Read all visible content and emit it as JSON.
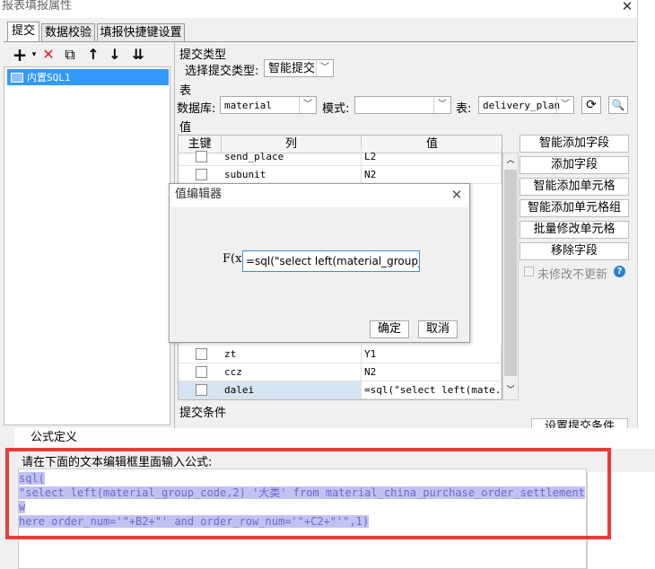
{
  "window": {
    "title": "报表填报属性"
  },
  "tabs": [
    {
      "label": "提交"
    },
    {
      "label": "数据校验"
    },
    {
      "label": "填报快捷键设置"
    }
  ],
  "tree": {
    "items": [
      {
        "label": "内置SQL1"
      }
    ]
  },
  "submit_type": {
    "section": "提交类型",
    "label": "选择提交类型:",
    "value": "智能提交"
  },
  "table": {
    "section": "表",
    "db_label": "数据库:",
    "db_value": "material",
    "schema_label": "模式:",
    "schema_value": "",
    "table_label": "表:",
    "table_value": "delivery_plan"
  },
  "values": {
    "section": "值",
    "headers": {
      "key": "主键",
      "column": "列",
      "value": "值"
    },
    "rows_top": [
      {
        "column": "send_place",
        "value": "L2"
      },
      {
        "column": "subunit",
        "value": "N2"
      }
    ],
    "rows_bottom": [
      {
        "column": "zt",
        "value": "Y1"
      },
      {
        "column": "ccz",
        "value": "N2"
      },
      {
        "column": "dalei",
        "value": "=sql(\"select left(mate..."
      }
    ]
  },
  "side_buttons": [
    "智能添加字段",
    "添加字段",
    "智能添加单元格",
    "智能添加单元格组",
    "批量修改单元格",
    "移除字段"
  ],
  "no_change": "未修改不更新",
  "submit_condition": {
    "section": "提交条件",
    "button": "设置提交条件"
  },
  "value_editor": {
    "title": "值编辑器",
    "fx": "F(x)",
    "input": "=sql(\"select left(material_group_co",
    "ok": "确定",
    "cancel": "取消"
  },
  "formula": {
    "title": "公式定义",
    "hint": "请在下面的文本编辑框里面输入公式:",
    "lines": [
      "sql(",
      "\"select left(material_group_code,2) '大类' from material_china_purchase_order_settlement w",
      "here order_num='\"+B2+\"' and order_row_num='\"+C2+\"'\",1)"
    ]
  },
  "colors": {
    "selection": "#3399ff",
    "highlight_frame": "#ee3a3a",
    "text_selection": "#c2c2f2"
  }
}
